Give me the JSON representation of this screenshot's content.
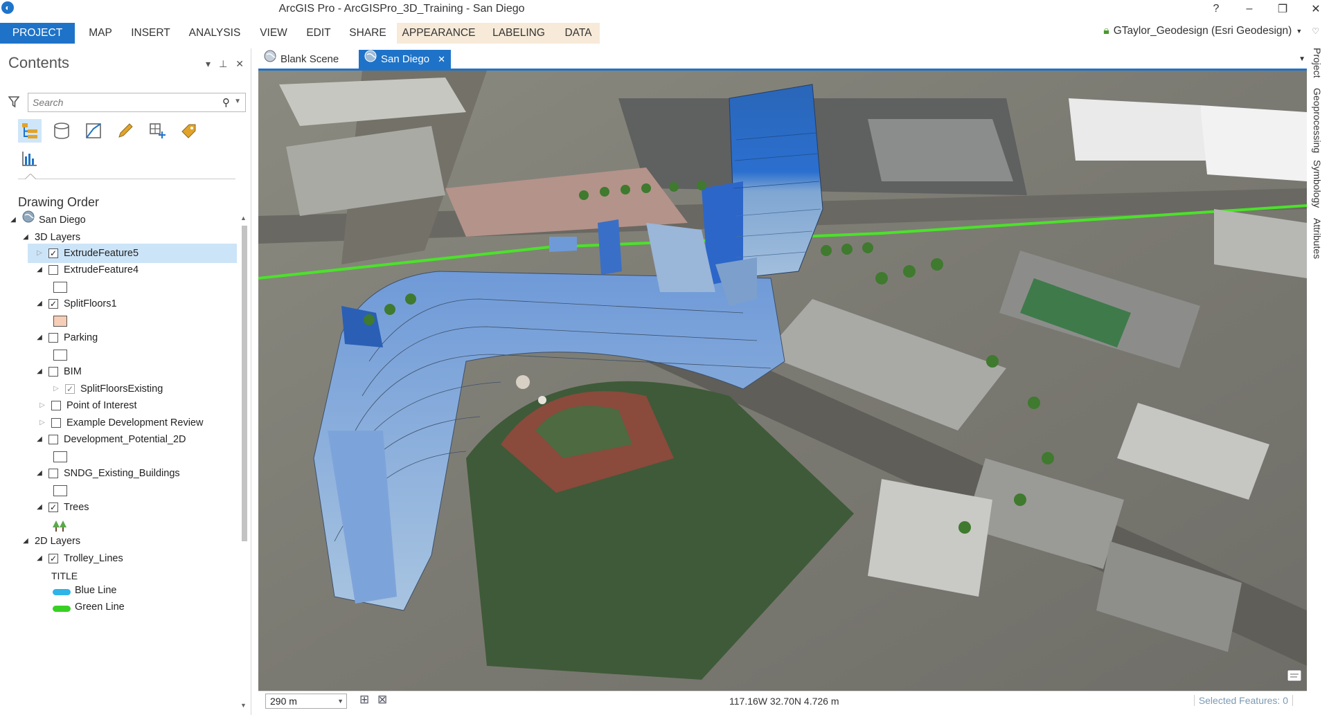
{
  "titlebar": {
    "title": "ArcGIS Pro - ArcGISPro_3D_Training - San Diego",
    "help": "?",
    "minimize": "–",
    "restore": "❐",
    "close": "✕"
  },
  "ribbon": {
    "tabs": [
      "PROJECT",
      "MAP",
      "INSERT",
      "ANALYSIS",
      "VIEW",
      "EDIT",
      "SHARE",
      "APPEARANCE",
      "LABELING",
      "DATA"
    ],
    "user": "GTaylor_Geodesign (Esri Geodesign)"
  },
  "contents": {
    "title": "Contents",
    "search_placeholder": "Search",
    "section": "Drawing Order",
    "map": "San Diego",
    "group_3d": "3D Layers",
    "group_2d": "2D Layers",
    "layers": {
      "extrude5": "ExtrudeFeature5",
      "extrude4": "ExtrudeFeature4",
      "splitfloors1": "SplitFloors1",
      "parking": "Parking",
      "bim": "BIM",
      "splitfloorsexisting": "SplitFloorsExisting",
      "poi": "Point of Interest",
      "edr": "Example Development Review",
      "devpot": "Development_Potential_2D",
      "sndg": "SNDG_Existing_Buildings",
      "trees": "Trees",
      "trolley": "Trolley_Lines"
    },
    "legend_title": "TITLE",
    "legend_blue": "Blue Line",
    "legend_green": "Green Line",
    "colors": {
      "blue_line": "#2fb4e8",
      "green_line": "#39d024",
      "splitfloors_swatch": "#f6cdb6"
    }
  },
  "doc_tabs": {
    "blank": "Blank Scene",
    "active": "San Diego"
  },
  "status": {
    "scale": "290 m",
    "coords": "117.16W 32.70N  4.726 m",
    "selected": "Selected Features: 0"
  },
  "right_rail": [
    "Project",
    "Geoprocessing",
    "Symbology",
    "Attributes"
  ]
}
